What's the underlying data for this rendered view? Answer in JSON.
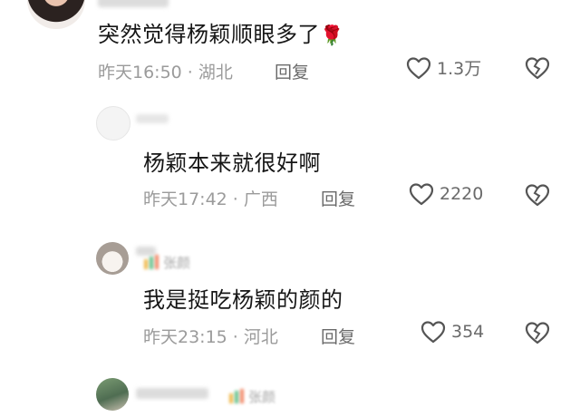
{
  "comments": [
    {
      "text": "突然觉得杨颖顺眼多了",
      "emoji": "🌹",
      "time": "昨天16:50",
      "location": "湖北",
      "reply_label": "回复",
      "likes": "1.3万"
    },
    {
      "text": "杨颖本来就很好啊",
      "time": "昨天17:42",
      "location": "广西",
      "reply_label": "回复",
      "likes": "2220"
    },
    {
      "badge": "张颜",
      "text": "我是挺吃杨颖的颜的",
      "time": "昨天23:15",
      "location": "河北",
      "reply_label": "回复",
      "likes": "354"
    },
    {
      "badge": "张颜"
    }
  ],
  "icons": [
    "heart-outline-icon",
    "broken-heart-icon",
    "rose-emoji"
  ]
}
